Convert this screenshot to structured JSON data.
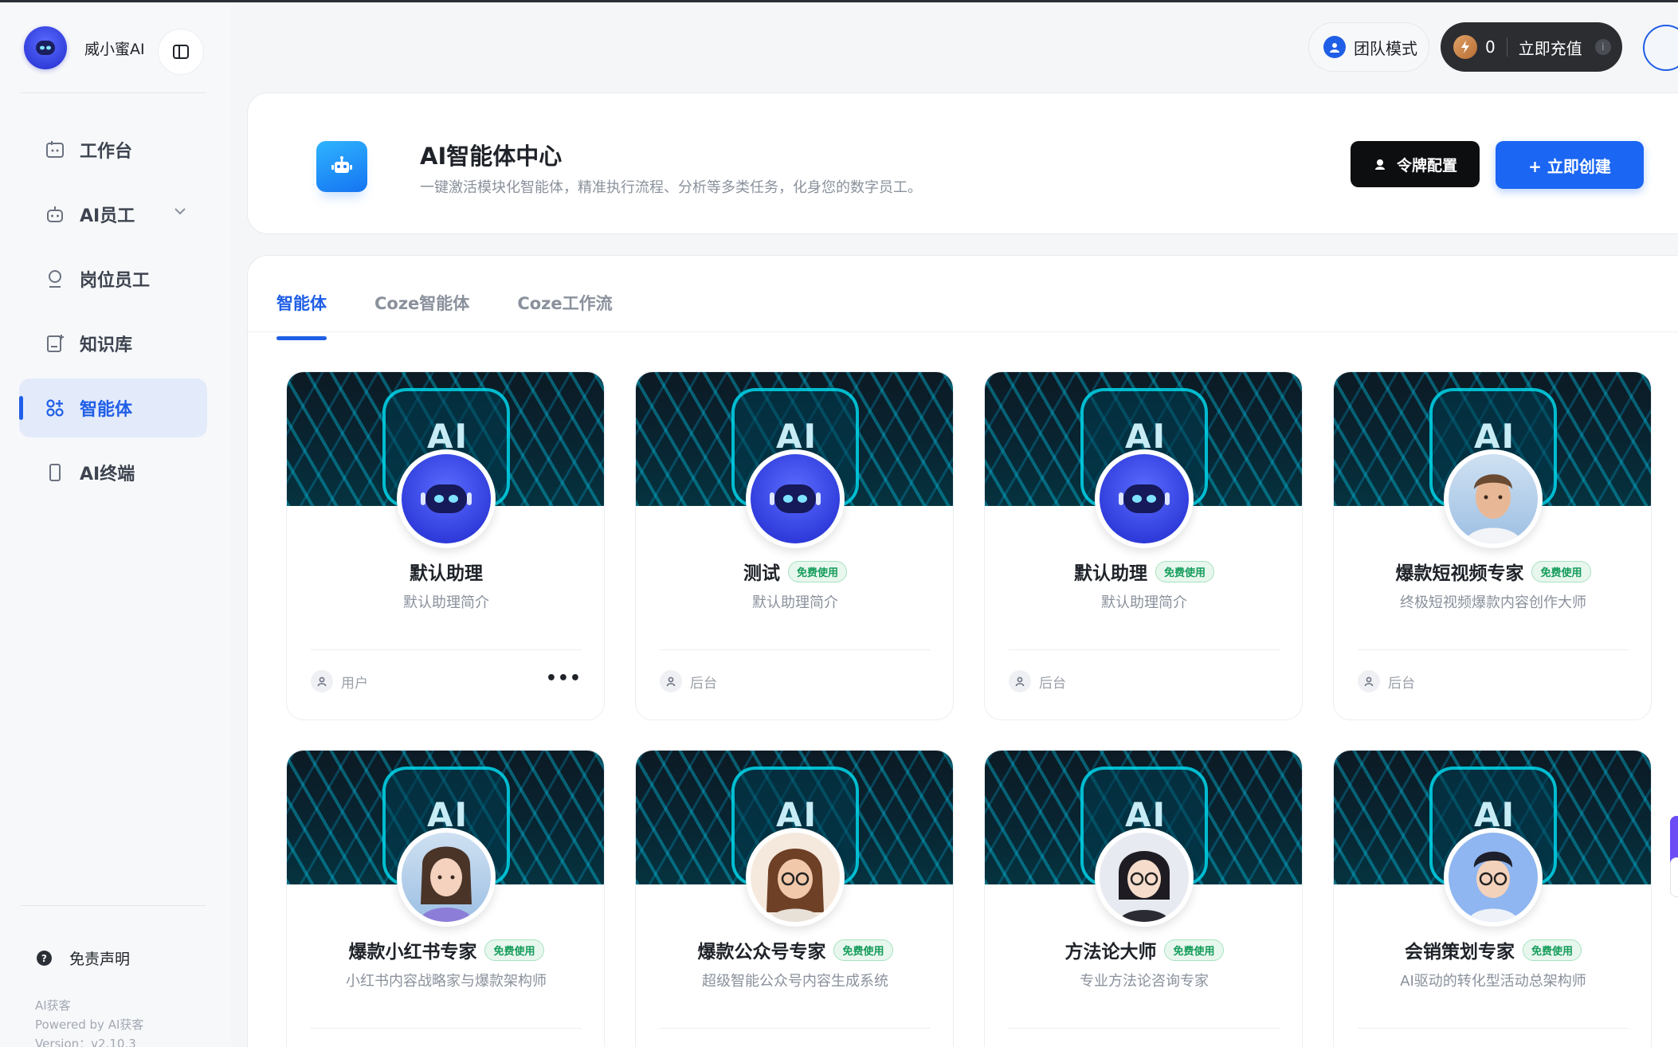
{
  "brand": {
    "name": "威小蜜AI"
  },
  "sidebar": {
    "items": [
      {
        "label": "工作台",
        "icon": "workbench-icon"
      },
      {
        "label": "AI员工",
        "icon": "robot-icon",
        "expandable": true
      },
      {
        "label": "岗位员工",
        "icon": "person-icon"
      },
      {
        "label": "知识库",
        "icon": "knowledge-icon"
      },
      {
        "label": "智能体",
        "icon": "agents-icon",
        "active": true
      },
      {
        "label": "AI终端",
        "icon": "phone-icon"
      }
    ],
    "disclaimer": "免责声明",
    "footer": {
      "company": "AI获客",
      "powered": "Powered by AI获客",
      "version": "Version：v2.10.3"
    }
  },
  "topbar": {
    "team_mode": "团队模式",
    "credits": "0",
    "recharge": "立即充值"
  },
  "header": {
    "title": "AI智能体中心",
    "subtitle": "一键激活模块化智能体，精准执行流程、分析等多类任务，化身您的数字员工。",
    "token_button": "令牌配置",
    "create_button": "+ 立即创建"
  },
  "tabs": [
    {
      "label": "智能体",
      "active": true
    },
    {
      "label": "Coze智能体",
      "active": false
    },
    {
      "label": "Coze工作流",
      "active": false
    }
  ],
  "banner_text": "AI",
  "badge_free": "免费使用",
  "cards": [
    {
      "title": "默认助理",
      "desc": "默认助理简介",
      "owner": "用户",
      "badge": false,
      "avatar": "robot",
      "more": true
    },
    {
      "title": "测试",
      "desc": "默认助理简介",
      "owner": "后台",
      "badge": true,
      "avatar": "robot"
    },
    {
      "title": "默认助理",
      "desc": "默认助理简介",
      "owner": "后台",
      "badge": true,
      "avatar": "robot"
    },
    {
      "title": "爆款短视频专家",
      "desc": "终极短视频爆款内容创作大师",
      "owner": "后台",
      "badge": true,
      "avatar": "man"
    },
    {
      "title": "爆款小红书专家",
      "desc": "小红书内容战略家与爆款架构师",
      "owner": "",
      "badge": true,
      "avatar": "woman1"
    },
    {
      "title": "爆款公众号专家",
      "desc": "超级智能公众号内容生成系统",
      "owner": "",
      "badge": true,
      "avatar": "woman2"
    },
    {
      "title": "方法论大师",
      "desc": "专业方法论咨询专家",
      "owner": "",
      "badge": true,
      "avatar": "woman3"
    },
    {
      "title": "会销策划专家",
      "desc": "AI驱动的转化型活动总架构师",
      "owner": "",
      "badge": true,
      "avatar": "boy"
    }
  ],
  "colors": {
    "accent": "#1f5ee6",
    "create": "#1b66f2",
    "badge_green": "#149c5a",
    "dark": "#0d0e10"
  }
}
